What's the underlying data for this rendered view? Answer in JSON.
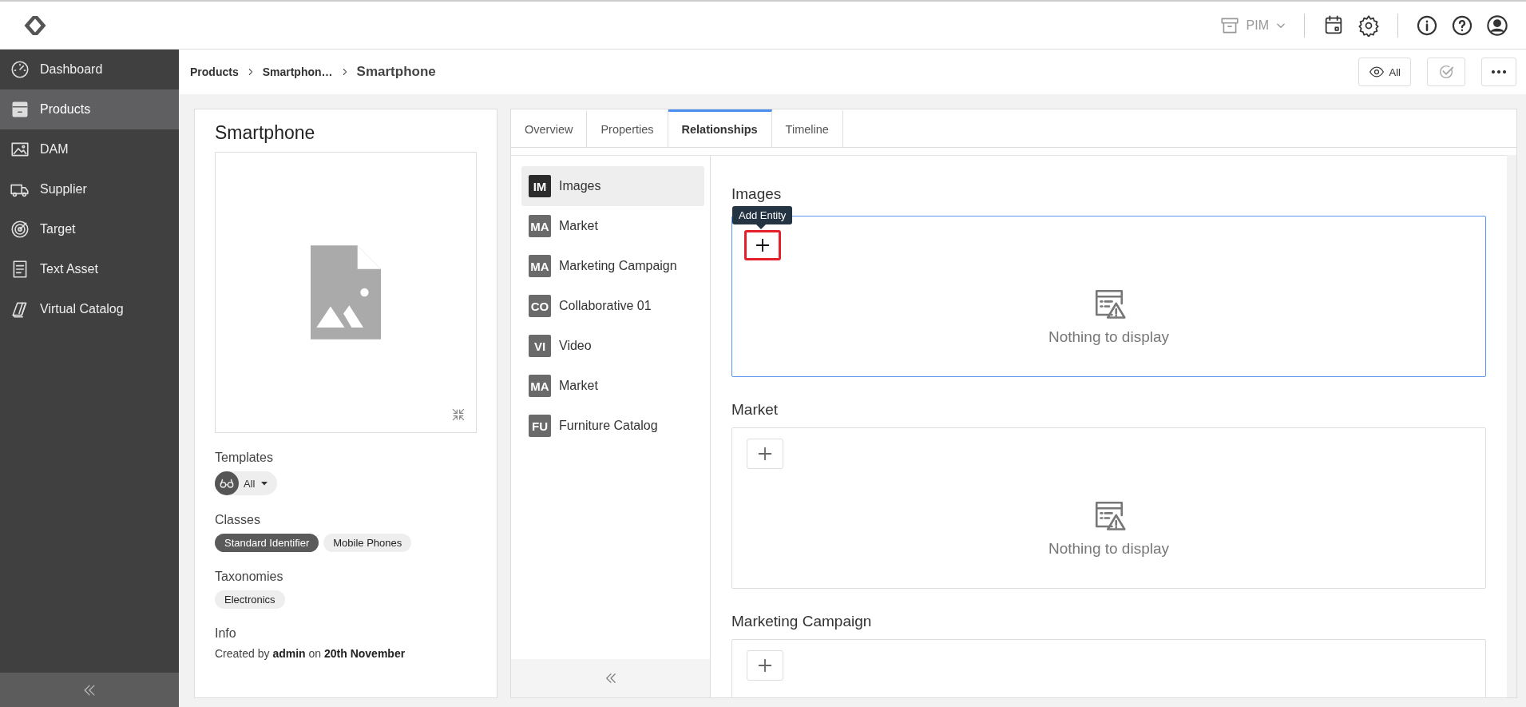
{
  "header": {
    "app_switcher": {
      "label": "PIM",
      "disabled": true
    }
  },
  "sidebar": {
    "items": [
      {
        "label": "Dashboard",
        "kind": "dashboard",
        "selected": false
      },
      {
        "label": "Products",
        "kind": "products",
        "selected": true
      },
      {
        "label": "DAM",
        "kind": "dam",
        "selected": false
      },
      {
        "label": "Supplier",
        "kind": "supplier",
        "selected": false
      },
      {
        "label": "Target",
        "kind": "target",
        "selected": false
      },
      {
        "label": "Text Asset",
        "kind": "textasset",
        "selected": false
      },
      {
        "label": "Virtual Catalog",
        "kind": "catalog",
        "selected": false
      }
    ]
  },
  "breadcrumb": {
    "items": [
      "Products",
      "Smartphon…"
    ],
    "current": "Smartphone"
  },
  "view_filter": {
    "label": "All"
  },
  "product": {
    "title": "Smartphone",
    "templates": {
      "label": "Templates",
      "value": "All"
    },
    "classes": {
      "label": "Classes",
      "items": [
        {
          "label": "Standard Identifier",
          "primary": true
        },
        {
          "label": "Mobile Phones",
          "primary": false
        }
      ]
    },
    "taxonomies": {
      "label": "Taxonomies",
      "items": [
        "Electronics"
      ]
    },
    "info": {
      "label": "Info",
      "text": "Created by **admin** on **20th November**"
    }
  },
  "tabs": [
    {
      "label": "Overview",
      "selected": false
    },
    {
      "label": "Properties",
      "selected": false
    },
    {
      "label": "Relationships",
      "selected": true
    },
    {
      "label": "Timeline",
      "selected": false
    }
  ],
  "relationships": [
    {
      "badge": "IM",
      "label": "Images",
      "selected": true
    },
    {
      "badge": "MA",
      "label": "Market",
      "selected": false
    },
    {
      "badge": "MA",
      "label": "Marketing Campaign",
      "selected": false
    },
    {
      "badge": "CO",
      "label": "Collaborative 01",
      "selected": false
    },
    {
      "badge": "VI",
      "label": "Video",
      "selected": false
    },
    {
      "badge": "MA",
      "label": "Market",
      "selected": false
    },
    {
      "badge": "FU",
      "label": "Furniture Catalog",
      "selected": false
    }
  ],
  "sections": [
    {
      "title": "Images",
      "focused": true,
      "add_highlighted": true,
      "tooltip": "Add Entity",
      "empty_text": "Nothing to display"
    },
    {
      "title": "Market",
      "focused": false,
      "add_highlighted": false,
      "empty_text": "Nothing to display"
    },
    {
      "title": "Marketing Campaign",
      "focused": false,
      "add_highlighted": false
    }
  ]
}
